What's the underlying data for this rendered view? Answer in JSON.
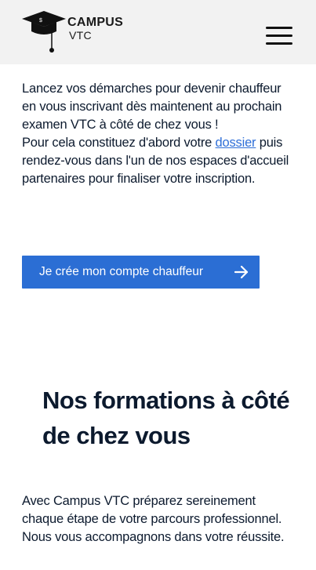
{
  "header": {
    "logo_line1": "CAMPUS",
    "logo_line2": "VTC",
    "menu_icon": "hamburger-icon"
  },
  "intro": {
    "paragraph1": "Lancez vos démarches pour devenir chauffeur en vous inscrivant dès maintenent au prochain examen VTC à côté de chez vous !",
    "paragraph2_before": "Pour cela constituez d'abord votre ",
    "paragraph2_link": "dossier",
    "paragraph2_after": " puis rendez-vous dans l'un de nos espaces d'accueil partenaires pour finaliser votre inscription."
  },
  "cta": {
    "label": "Je crée mon compte chauffeur",
    "icon": "arrow-right-icon"
  },
  "formations": {
    "title": "Nos formations à côté de chez vous",
    "text": "Avec Campus VTC préparez sereinement chaque étape de votre parcours professionnel. Nous vous accompagnons dans votre réussite."
  },
  "colors": {
    "header_bg": "#f2f2f2",
    "accent": "#2b6ed4",
    "link": "#2f6fd8",
    "text": "#0c1a2e"
  }
}
